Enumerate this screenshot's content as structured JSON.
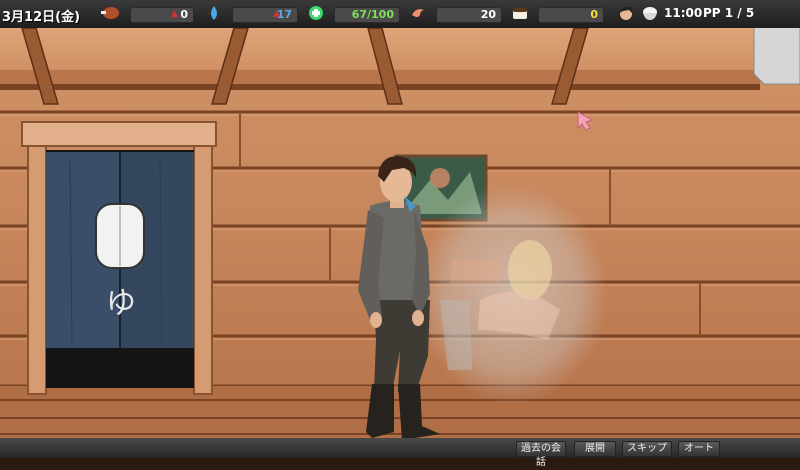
{
  "hud": {
    "date": "3月12日(金)",
    "stats": [
      {
        "icon": "meat-icon",
        "value": "0",
        "color": "#ffffff"
      },
      {
        "icon": "water-drop-icon",
        "value": "17",
        "color": "#5aa8e8"
      },
      {
        "icon": "health-cross-icon",
        "value": "67/100",
        "color": "#7ee05a"
      },
      {
        "icon": "shrimp-icon",
        "value": "20",
        "color": "#ffffff"
      },
      {
        "icon": "sushi-icon",
        "value": "0",
        "color": "#f2e040"
      }
    ],
    "time": "11:00",
    "pp": "PP 1 / 5"
  },
  "scene": {
    "curtain_glyph": "ゆ"
  },
  "menu": {
    "log": "過去の会話",
    "expand": "展開",
    "skip": "スキップ",
    "auto": "オート"
  },
  "colors": {
    "wood": "#c98a5c",
    "wood_dark": "#8a4e2a",
    "curtain": "#3a4e6a",
    "hud_bg": "#2c2c2c"
  }
}
